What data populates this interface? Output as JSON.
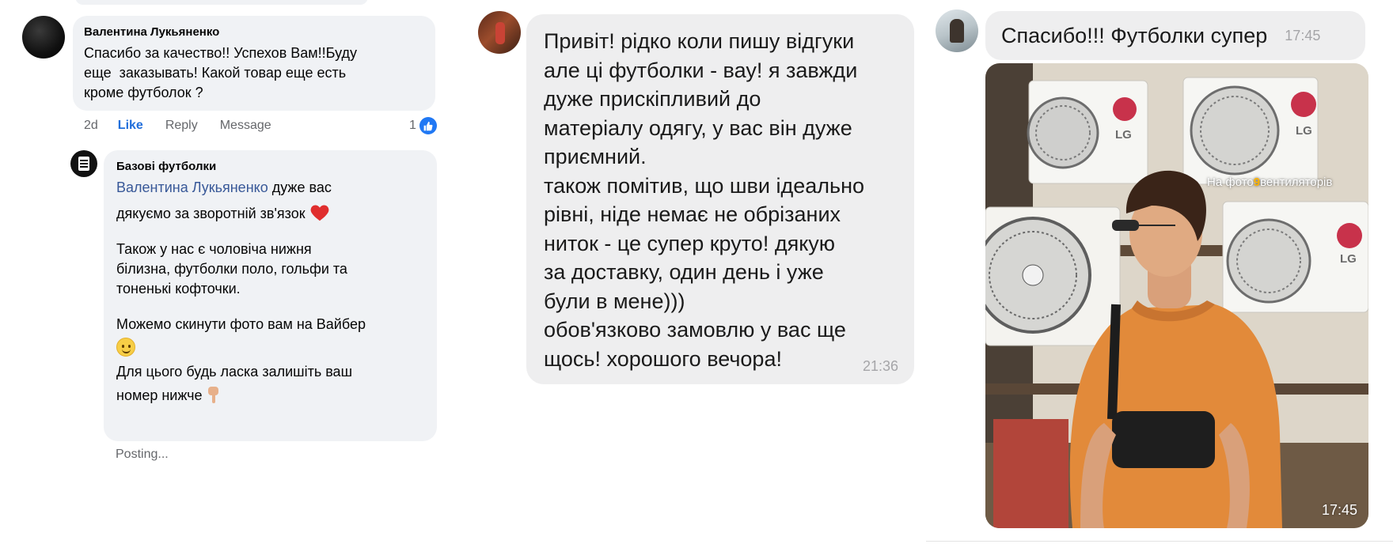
{
  "facebook": {
    "comment": {
      "author": "Валентина Лукьяненко",
      "lines": [
        "Спасибо за качество!! Успехов Вам!!Буду",
        "еще  заказывать! Какой товар еще есть",
        "кроме футболок ?"
      ],
      "time": "2d",
      "like_label": "Like",
      "reply_label": "Reply",
      "message_label": "Message",
      "reaction_count": "1"
    },
    "reply": {
      "author": "Базові футболки",
      "mention": "Валентина Лукьяненко",
      "line1_rest": " дуже вас",
      "line2": "дякуємо за зворотній зв'язок ",
      "para2": [
        "Також у нас є чоловіча нижня",
        "білизна, футболки поло, гольфи та",
        "тоненькі кофточки."
      ],
      "para3": "Можемо скинути фото вам на Вайбер",
      "para4": [
        "Для цього будь ласка залишіть ваш",
        "номер нижче "
      ],
      "status": "Posting..."
    },
    "heart_color": "#e02e2e",
    "like_color": "#216fdb"
  },
  "middle_chat": {
    "message": "Привіт! рідко коли пишу відгуки\nале ці футболки - вау! я завжди\nдуже прискіпливий до\nматеріалу одягу, у вас він дуже\nприємний.\nтакож помітив, що шви ідеально\nрівні, ніде немає не обрізаних\nниток - це супер круто! дякую\nза доставку, один день і уже\nбули в мене)))\nобов'язково замовлю у вас ще\nщось! хорошого вечора!",
    "time": "21:36"
  },
  "right_chat": {
    "message": "Спасибо!!! Футболки супер",
    "time": "17:45",
    "photo": {
      "overlay_prefix": "На фото",
      "overlay_number": "9",
      "overlay_suffix": "вентиляторів",
      "brand": "LG",
      "time": "17:45",
      "shirt_color": "#e28a3a"
    }
  }
}
